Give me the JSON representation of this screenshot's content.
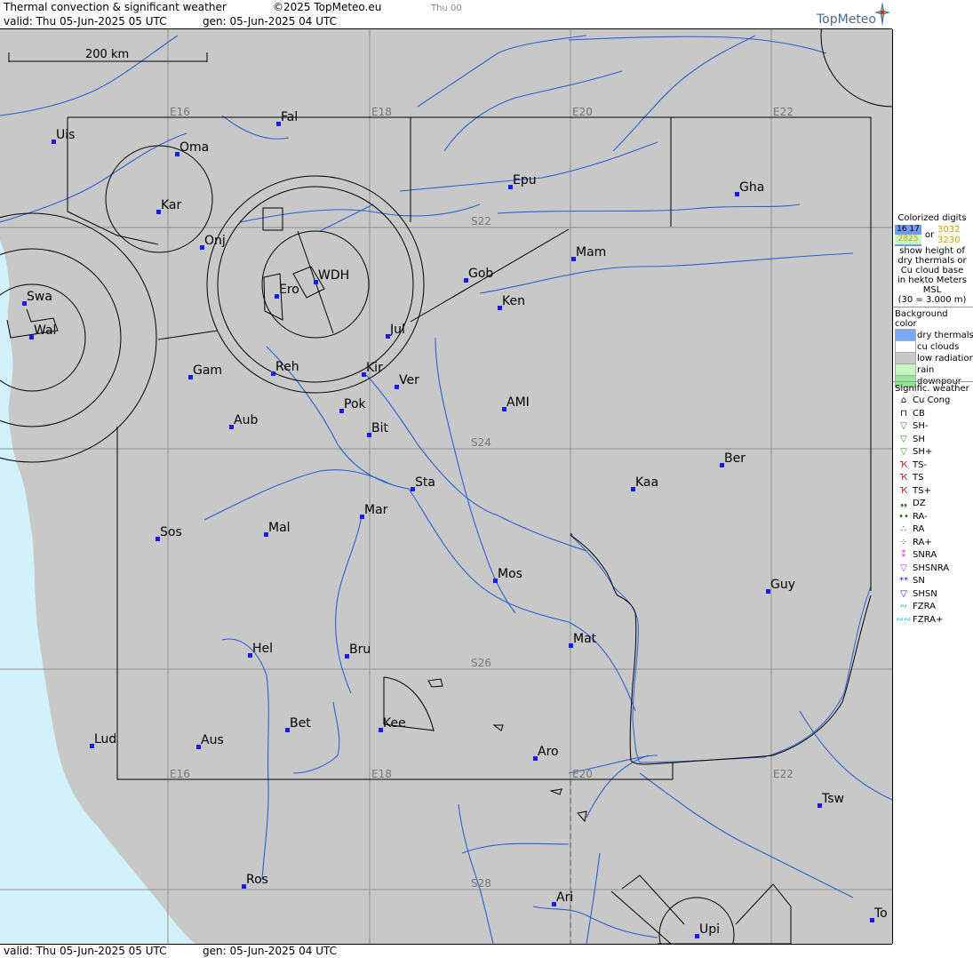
{
  "header": {
    "title": "Thermal convection & significant weather",
    "copyright": "©2025 TopMeteo.eu",
    "day": "Thu 00",
    "valid": "valid:  Thu  05-Jun-2025  05 UTC",
    "gen": "gen: 05-Jun-2025 04 UTC",
    "logo": "TopMeteo"
  },
  "footer": {
    "valid": "valid:  Thu  05-Jun-2025  05 UTC",
    "gen": "gen: 05-Jun-2025 04 UTC"
  },
  "map": {
    "scale": "200 km",
    "grid_labels": {
      "lon": [
        "E16",
        "E18",
        "E20",
        "E22"
      ],
      "lat": [
        "S22",
        "S24",
        "S26",
        "S28"
      ]
    },
    "colors": {
      "land": "#c8c8c8",
      "sea": "#d3f1f8",
      "river": "#2e5fd1",
      "border": "#000000",
      "grid": "#909090",
      "city": "#1a1aff"
    },
    "cities": [
      {
        "label": "Uis"
      },
      {
        "label": "Fal"
      },
      {
        "label": "Oma"
      },
      {
        "label": "Kar"
      },
      {
        "label": "Epu"
      },
      {
        "label": "Gha"
      },
      {
        "label": "Onj"
      },
      {
        "label": "Mam"
      },
      {
        "label": "Swa"
      },
      {
        "label": "WDH"
      },
      {
        "label": "Gob"
      },
      {
        "label": "Ero"
      },
      {
        "label": "Ken"
      },
      {
        "label": "Wal"
      },
      {
        "label": "Jul"
      },
      {
        "label": "Gam"
      },
      {
        "label": "Reh"
      },
      {
        "label": "Kir"
      },
      {
        "label": "Ver"
      },
      {
        "label": "AMI"
      },
      {
        "label": "Pok"
      },
      {
        "label": "Aub"
      },
      {
        "label": "Bit"
      },
      {
        "label": "Ber"
      },
      {
        "label": "Sta"
      },
      {
        "label": "Kaa"
      },
      {
        "label": "Mar"
      },
      {
        "label": "Sos"
      },
      {
        "label": "Mal"
      },
      {
        "label": "Mos"
      },
      {
        "label": "Guy"
      },
      {
        "label": "Mat"
      },
      {
        "label": "Hel"
      },
      {
        "label": "Bru"
      },
      {
        "label": "Bet"
      },
      {
        "label": "Kee"
      },
      {
        "label": "Lud"
      },
      {
        "label": "Aus"
      },
      {
        "label": "Aro"
      },
      {
        "label": "Tsw"
      },
      {
        "label": "Ros"
      },
      {
        "label": "Ari"
      },
      {
        "label": "To"
      },
      {
        "label": "Upi"
      }
    ]
  },
  "legend": {
    "colorized_title": "Colorized digits",
    "sample_a1": "16 17",
    "sample_a2": "2825",
    "or": "or",
    "sample_b1": "3032",
    "sample_b2": "3230",
    "desc": [
      "show height of",
      "dry thermals or",
      "Cu cloud base",
      "in hekto Meters",
      "MSL",
      "(30 = 3.000 m)"
    ],
    "bg_title": "Background color",
    "bg_items": [
      {
        "label": "dry thermals",
        "color": "#7aa8ff"
      },
      {
        "label": "cu clouds",
        "color": "#ffffff"
      },
      {
        "label": "low radiation",
        "color": "#c8c8c8"
      },
      {
        "label": "rain",
        "color": "#c8f5c0"
      },
      {
        "label": "downpour",
        "color": "#90e890"
      }
    ],
    "sig_title": "Signific. weather",
    "sig_items": [
      {
        "label": "Cu Cong",
        "icon": "cu-cong-icon",
        "color": "#000000",
        "glyph": "⌂"
      },
      {
        "label": "CB",
        "icon": "cb-icon",
        "color": "#000000",
        "glyph": "⊓"
      },
      {
        "label": "SH-",
        "icon": "shower-light-icon",
        "color": "#2a8a2a",
        "glyph": "▽"
      },
      {
        "label": "SH",
        "icon": "shower-icon",
        "color": "#2a8a2a",
        "glyph": "▽"
      },
      {
        "label": "SH+",
        "icon": "shower-heavy-icon",
        "color": "#2a8a2a",
        "glyph": "▽"
      },
      {
        "label": "TS-",
        "icon": "thunderstorm-light-icon",
        "color": "#c02020",
        "glyph": "Ҡ"
      },
      {
        "label": "TS",
        "icon": "thunderstorm-icon",
        "color": "#c02020",
        "glyph": "Ҡ"
      },
      {
        "label": "TS+",
        "icon": "thunderstorm-heavy-icon",
        "color": "#c02020",
        "glyph": "Ҡ"
      },
      {
        "label": "DZ",
        "icon": "drizzle-icon",
        "color": "#1a6a1a",
        "glyph": "❟❟"
      },
      {
        "label": "RA-",
        "icon": "rain-light-icon",
        "color": "#1a6a1a",
        "glyph": "••"
      },
      {
        "label": "RA",
        "icon": "rain-icon",
        "color": "#1a6a1a",
        "glyph": "∴"
      },
      {
        "label": "RA+",
        "icon": "rain-heavy-icon",
        "color": "#1a6a1a",
        "glyph": "⁘"
      },
      {
        "label": "SNRA",
        "icon": "snow-rain-icon",
        "color": "#c030c0",
        "glyph": "⁑"
      },
      {
        "label": "SHSNRA",
        "icon": "shower-snow-rain-icon",
        "color": "#c030c0",
        "glyph": "▽"
      },
      {
        "label": "SN",
        "icon": "snow-icon",
        "color": "#2020c0",
        "glyph": "**"
      },
      {
        "label": "SHSN",
        "icon": "shower-snow-icon",
        "color": "#2020c0",
        "glyph": "▽"
      },
      {
        "label": "FZRA",
        "icon": "freezing-rain-icon",
        "color": "#20c0d0",
        "glyph": "∾"
      },
      {
        "label": "FZRA+",
        "icon": "freezing-rain-heavy-icon",
        "color": "#20c0d0",
        "glyph": "∾∾"
      }
    ]
  }
}
